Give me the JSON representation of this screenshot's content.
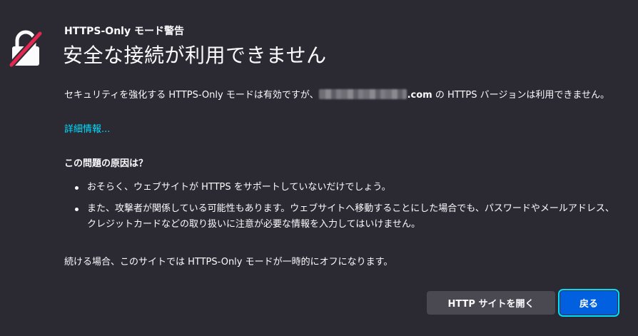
{
  "header": {
    "subtitle": "HTTPS-Only モード警告",
    "title": "安全な接続が利用できません"
  },
  "description": {
    "before_domain": "セキュリティを強化する HTTPS-Only モードは有効ですが、",
    "domain_suffix": ".com",
    "after_domain": " の HTTPS バージョンは利用できません。"
  },
  "learn_more": "詳細情報...",
  "section_heading": "この問題の原因は？",
  "reasons": [
    "おそらく、ウェブサイトが HTTPS をサポートしていないだけでしょう。",
    "また、攻撃者が関係している可能性もあります。ウェブサイトへ移動することにした場合でも、パスワードやメールアドレス、クレジットカードなどの取り扱いに注意が必要な情報を入力してはいけません。"
  ],
  "continue_note": "続ける場合、このサイトでは HTTPS-Only モードが一時的にオフになります。",
  "buttons": {
    "open_http": "HTTP サイトを開く",
    "go_back": "戻る"
  },
  "colors": {
    "background": "#2b2a33",
    "link": "#00ddff",
    "primary_button": "#0060df",
    "lock_slash": "#e22850"
  },
  "icons": {
    "header": "broken-lock-icon"
  }
}
